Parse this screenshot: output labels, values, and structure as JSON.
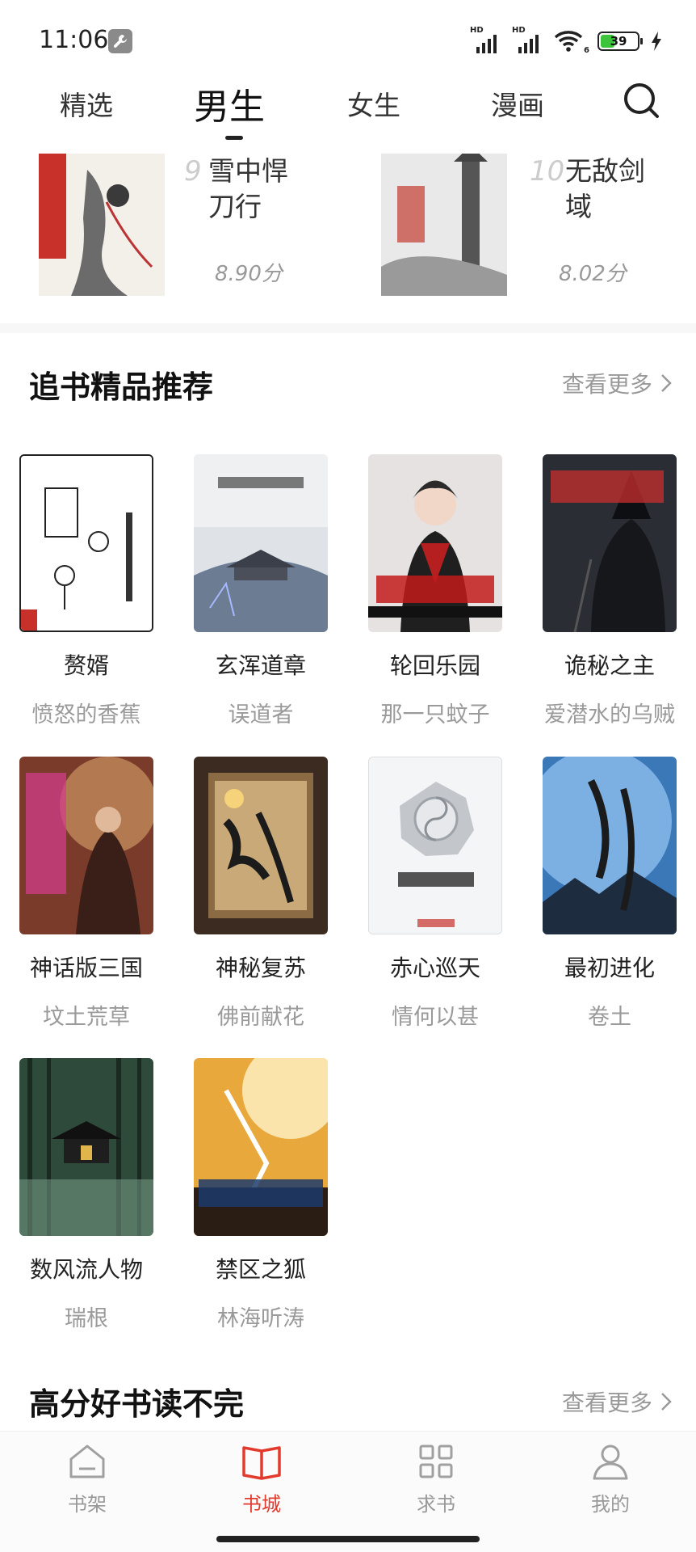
{
  "status_bar": {
    "time": "11:06",
    "signal_1_label": "HD",
    "signal_2_label": "HD",
    "wifi_badge": "6",
    "battery_level": 39,
    "icons": [
      "wrench-icon",
      "signal-icon",
      "signal-icon",
      "wifi-icon",
      "battery-icon",
      "charging-icon"
    ]
  },
  "top_tabs": {
    "items": [
      {
        "label": "精选"
      },
      {
        "label": "男生"
      },
      {
        "label": "女生"
      },
      {
        "label": "漫画"
      }
    ],
    "active_index": 1,
    "search_icon": "search-icon"
  },
  "ranking": {
    "items": [
      {
        "rank": "9",
        "title": "雪中悍刀行",
        "score": "8.90分"
      },
      {
        "rank": "10",
        "title": "无敌剑域",
        "score": "8.02分"
      }
    ]
  },
  "section_recommend": {
    "title": "追书精品推荐",
    "see_more": "查看更多",
    "books": [
      {
        "title": "赘婿",
        "author": "愤怒的香蕉"
      },
      {
        "title": "玄浑道章",
        "author": "误道者"
      },
      {
        "title": "轮回乐园",
        "author": "那一只蚊子"
      },
      {
        "title": "诡秘之主",
        "author": "爱潜水的乌贼"
      },
      {
        "title": "神话版三国",
        "author": "坟土荒草"
      },
      {
        "title": "神秘复苏",
        "author": "佛前献花"
      },
      {
        "title": "赤心巡天",
        "author": "情何以甚"
      },
      {
        "title": "最初进化",
        "author": "卷土"
      },
      {
        "title": "数风流人物",
        "author": "瑞根"
      },
      {
        "title": "禁区之狐",
        "author": "林海听涛"
      }
    ]
  },
  "section_high_score": {
    "title": "高分好书读不完",
    "see_more": "查看更多"
  },
  "bottom_nav": {
    "items": [
      {
        "label": "书架",
        "icon": "bookshelf-icon"
      },
      {
        "label": "书城",
        "icon": "book-open-icon"
      },
      {
        "label": "求书",
        "icon": "grid-icon"
      },
      {
        "label": "我的",
        "icon": "person-icon"
      }
    ],
    "active_index": 1
  },
  "colors": {
    "accent": "#e23b2e",
    "muted": "#999999"
  }
}
